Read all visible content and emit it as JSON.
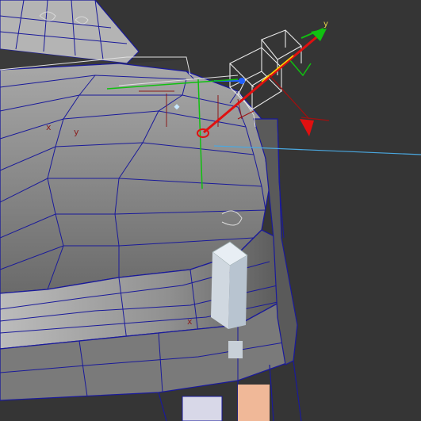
{
  "viewport": {
    "background": "#353535",
    "mesh_color": "#1a1a9a",
    "mesh_fill": "#8c8c8c",
    "selection_color": "#ffffff"
  },
  "gizmo": {
    "x_color": "#e01010",
    "y_color": "#10c010",
    "z_color": "#2060ff",
    "selected_color": "#ffd400",
    "label_y": "y"
  },
  "pivot_labels": {
    "x1": "x",
    "y1": "y",
    "x2": "x"
  },
  "guide_line_color": "#4aa8e0"
}
